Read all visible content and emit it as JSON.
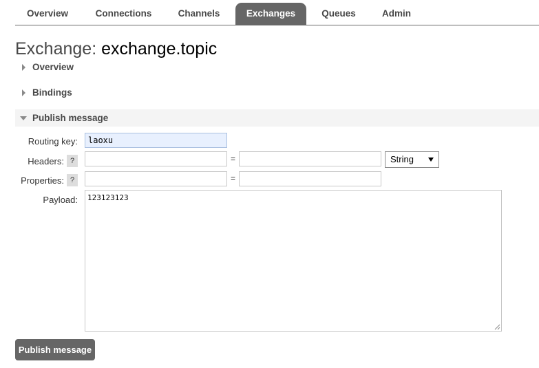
{
  "nav": {
    "tabs": [
      {
        "label": "Overview"
      },
      {
        "label": "Connections"
      },
      {
        "label": "Channels"
      },
      {
        "label": "Exchanges",
        "active": true
      },
      {
        "label": "Queues"
      },
      {
        "label": "Admin"
      }
    ]
  },
  "page": {
    "title_prefix": "Exchange: ",
    "title_name": "exchange.topic"
  },
  "sections": {
    "overview": {
      "label": "Overview",
      "expanded": false
    },
    "bindings": {
      "label": "Bindings",
      "expanded": false
    },
    "publish": {
      "label": "Publish message",
      "expanded": true
    }
  },
  "publish_form": {
    "routing_key": {
      "label": "Routing key:",
      "value": "laoxu"
    },
    "headers": {
      "label": "Headers:",
      "help": "?",
      "key": "",
      "equals": "=",
      "value": "",
      "type": "String"
    },
    "properties": {
      "label": "Properties:",
      "help": "?",
      "key": "",
      "equals": "=",
      "value": ""
    },
    "payload": {
      "label": "Payload:",
      "value": "123123123"
    },
    "submit_label": "Publish message"
  },
  "colors": {
    "tab_active_bg": "#666666",
    "routing_key_bg": "#e8f0fe",
    "button_bg": "#666666"
  }
}
